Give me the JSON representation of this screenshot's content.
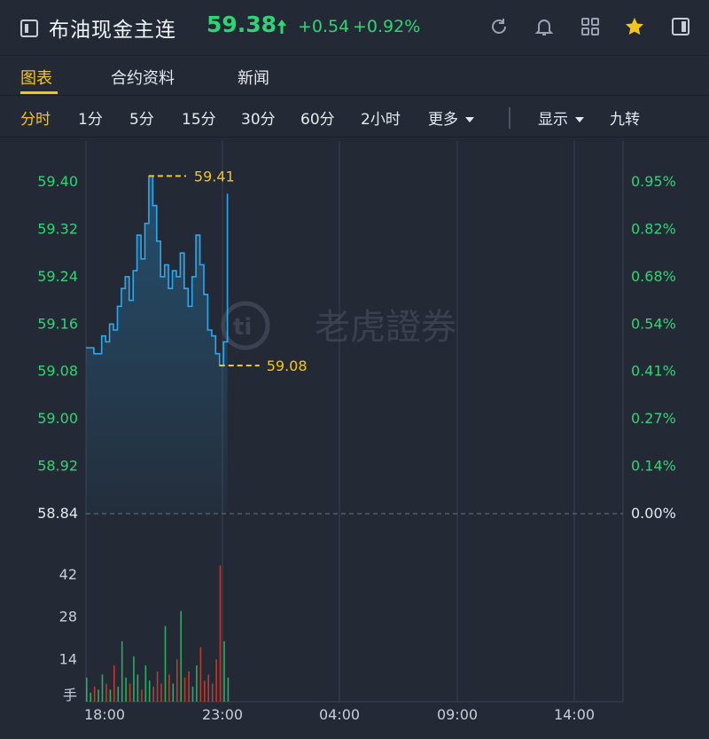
{
  "header": {
    "title": "布油现金主连",
    "price": "59.38",
    "change": "+0.54",
    "change_pct": "+0.92%",
    "icons": [
      "refresh-icon",
      "bell-icon",
      "grid-icon",
      "star-icon",
      "sidebar-icon"
    ]
  },
  "tabs": [
    "图表",
    "合约资料",
    "新闻"
  ],
  "periods": {
    "items": [
      "分时",
      "1分",
      "5分",
      "15分",
      "30分",
      "60分",
      "2小时"
    ],
    "more": "更多",
    "display": "显示",
    "nine": "九转"
  },
  "watermark": "老虎證券",
  "colors": {
    "up": "#2ed573",
    "accent": "#f5c518",
    "line": "#2aa9ef",
    "bg": "#232a36",
    "volume_red": "#c0392b",
    "volume_green": "#27ae60"
  },
  "chart_data": {
    "type": "line",
    "price_ticks": [
      "59.40",
      "59.32",
      "59.24",
      "59.16",
      "59.08",
      "59.00",
      "58.92",
      "58.84"
    ],
    "pct_ticks": [
      "0.95%",
      "0.82%",
      "0.68%",
      "0.54%",
      "0.41%",
      "0.27%",
      "0.14%",
      "0.00%"
    ],
    "ylim": [
      58.84,
      59.43
    ],
    "base": 58.84,
    "high_label": "59.41",
    "low_label": "59.08",
    "time_ticks": [
      "18:00",
      "23:00",
      "04:00",
      "09:00",
      "14:00"
    ],
    "volume_ticks": [
      "42",
      "28",
      "14"
    ],
    "volume_unit": "手",
    "points_per_hour": 6,
    "prices": [
      59.12,
      59.12,
      59.11,
      59.11,
      59.14,
      59.13,
      59.16,
      59.15,
      59.19,
      59.22,
      59.24,
      59.2,
      59.25,
      59.31,
      59.27,
      59.33,
      59.41,
      59.36,
      59.3,
      59.24,
      59.26,
      59.22,
      59.25,
      59.24,
      59.28,
      59.22,
      59.19,
      59.24,
      59.31,
      59.26,
      59.21,
      59.15,
      59.14,
      59.11,
      59.09,
      59.13,
      59.38
    ],
    "volumes": [
      8,
      3,
      5,
      4,
      9,
      6,
      4,
      12,
      5,
      20,
      8,
      6,
      15,
      9,
      4,
      12,
      7,
      5,
      10,
      6,
      25,
      9,
      6,
      14,
      30,
      8,
      10,
      5,
      12,
      18,
      7,
      9,
      6,
      14,
      45,
      20,
      8
    ]
  }
}
